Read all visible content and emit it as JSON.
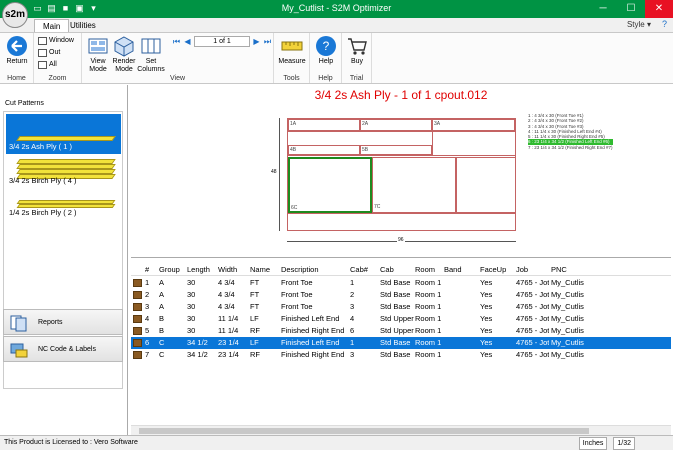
{
  "window": {
    "title": "My_Cutlist - S2M Optimizer",
    "logo": "s2m"
  },
  "tabs": [
    {
      "label": "Main"
    },
    {
      "label": "Utilities"
    }
  ],
  "style_menu": "Style",
  "ribbon": {
    "return": "Return",
    "window": "Window",
    "out": "Out",
    "all": "All",
    "view_mode": "View Mode",
    "render_mode": "Render Mode",
    "set_columns": "Set Columns",
    "page_indicator": "1 of 1",
    "measure": "Measure",
    "help": "Help",
    "buy": "Buy",
    "groups": {
      "home": "Home",
      "zoom": "Zoom",
      "view": "View",
      "tools": "Tools",
      "help": "Help",
      "trial": "Trial"
    }
  },
  "left_panel": {
    "title": "Cut Patterns",
    "patterns": [
      {
        "label": "3/4 2s Ash Ply  ( 1 )"
      },
      {
        "label": "3/4 2s Birch Ply  ( 4 )"
      },
      {
        "label": "1/4 2s Birch Ply  ( 2 )"
      }
    ],
    "nav": [
      {
        "label": "Reports"
      },
      {
        "label": "NC Code & Labels"
      }
    ]
  },
  "drawing": {
    "title": "3/4 2s Ash Ply - 1 of 1 cpout.012",
    "width_dim": "96",
    "height_dim": "48",
    "parts": [
      "1A",
      "2A",
      "3A",
      "4B",
      "5B",
      "6C",
      "7C"
    ],
    "legend": [
      "1 : 4 3/4 x 30 (Front Toe #1)",
      "2 : 4 3/4 x 30 (Front Toe #2)",
      "3 : 4 3/4 x 30 (Front Toe #3)",
      "4 : 11 1/4 x 30 (Finished Left End #4)",
      "5 : 11 1/4 x 30 (Finished Right End #5)",
      "6 : 23 1/4 x 34 1/2 (Finished Left End #6)",
      "7 : 23 1/4 x 34 1/2 (Finished Right End #7)"
    ]
  },
  "grid": {
    "headers": [
      "#",
      "Group",
      "Length",
      "Width",
      "Name",
      "Description",
      "Cab#",
      "Cab",
      "Room",
      "Band",
      "FaceUp",
      "Job",
      "PNC"
    ],
    "rows": [
      [
        "1",
        "A",
        "30",
        "4 3/4",
        "FT",
        "Front Toe",
        "1",
        "Std Base",
        "Room 1",
        "",
        "Yes",
        "4765 - Jot",
        "My_Cutlist"
      ],
      [
        "2",
        "A",
        "30",
        "4 3/4",
        "FT",
        "Front Toe",
        "2",
        "Std Base",
        "Room 1",
        "",
        "Yes",
        "4765 - Jot",
        "My_Cutlist"
      ],
      [
        "3",
        "A",
        "30",
        "4 3/4",
        "FT",
        "Front Toe",
        "3",
        "Std Base",
        "Room 1",
        "",
        "Yes",
        "4765 - Jot",
        "My_Cutlist"
      ],
      [
        "4",
        "B",
        "30",
        "11 1/4",
        "LF",
        "Finished Left End",
        "4",
        "Std Upper",
        "Room 1",
        "",
        "Yes",
        "4765 - Jot",
        "My_Cutlist"
      ],
      [
        "5",
        "B",
        "30",
        "11 1/4",
        "RF",
        "Finished Right End",
        "6",
        "Std Upper",
        "Room 1",
        "",
        "Yes",
        "4765 - Jot",
        "My_Cutlist"
      ],
      [
        "6",
        "C",
        "34 1/2",
        "23 1/4",
        "LF",
        "Finished Left End",
        "1",
        "Std Base",
        "Room 1",
        "",
        "Yes",
        "4765 - Jot",
        "My_Cutlist"
      ],
      [
        "7",
        "C",
        "34 1/2",
        "23 1/4",
        "RF",
        "Finished Right End",
        "3",
        "Std Base",
        "Room 1",
        "",
        "Yes",
        "4765 - Jot",
        "My_Cutlist"
      ]
    ],
    "selected_row": 5
  },
  "status": {
    "license": "This Product is Licensed to : Vero Software",
    "units": "Inches",
    "precision": "1/32"
  }
}
